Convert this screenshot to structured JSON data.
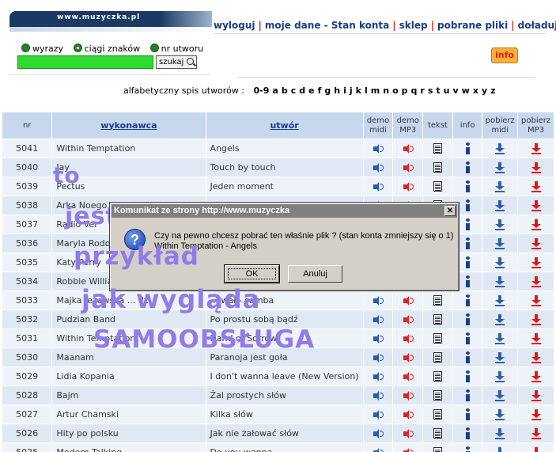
{
  "header": {
    "site_url": "www.muzyczka.pl",
    "nav": [
      "wyloguj",
      "moje dane - Stan konta",
      "sklep",
      "pobrane pliki",
      "doładuj konto"
    ],
    "info_badge": "info"
  },
  "search": {
    "options": [
      "wyrazy",
      "ciągi znaków",
      "nr utworu"
    ],
    "selected": "ciągi znaków",
    "input_value": "",
    "button_label": "szukaj"
  },
  "alphabet": {
    "label": "alfabetyczny spis utworów :",
    "letters": [
      "0-9",
      "a",
      "b",
      "c",
      "d",
      "e",
      "f",
      "g",
      "h",
      "i",
      "j",
      "k",
      "l",
      "m",
      "n",
      "o",
      "p",
      "q",
      "r",
      "s",
      "t",
      "u",
      "v",
      "w",
      "x",
      "y",
      "z"
    ]
  },
  "table": {
    "headers": {
      "nr": "nr",
      "artist": "wykonawca",
      "title": "utwór",
      "demo_midi": "demo midi",
      "demo_mp3": "demo MP3",
      "text": "tekst",
      "info": "info",
      "dl_midi": "pobierz midi",
      "dl_mp3": "pobierz MP3"
    },
    "rows": [
      {
        "nr": "5041",
        "artist": "Within Temptation",
        "title": "Angels"
      },
      {
        "nr": "5040",
        "artist": "Jay",
        "title": "Touch by touch"
      },
      {
        "nr": "5039",
        "artist": "Pectus",
        "title": "Jeden moment"
      },
      {
        "nr": "5038",
        "artist": "Arka Noego (c",
        "title": ""
      },
      {
        "nr": "5037",
        "artist": "Radio Ver",
        "title": ""
      },
      {
        "nr": "5036",
        "artist": "Maryla Rodow",
        "title": ""
      },
      {
        "nr": "5035",
        "artist": "Katy Perry",
        "title": ""
      },
      {
        "nr": "5034",
        "artist": "Robbie Williams",
        "title": ""
      },
      {
        "nr": "5033",
        "artist": "Majka Jeżowska ... dź",
        "title": "... wał - samba"
      },
      {
        "nr": "5032",
        "artist": "Pudzian Band",
        "title": "Po prostu sobą bądź"
      },
      {
        "nr": "5031",
        "artist": "Within Temptation",
        "title": "Hand of Sorrow"
      },
      {
        "nr": "5030",
        "artist": "Maanam",
        "title": "Paranoja jest goła"
      },
      {
        "nr": "5029",
        "artist": "Lidia Kopania",
        "title": "I don't wanna leave (New Version)"
      },
      {
        "nr": "5028",
        "artist": "Bajm",
        "title": "Żal prostych słów"
      },
      {
        "nr": "5027",
        "artist": "Artur Chamski",
        "title": "Kilka słów"
      },
      {
        "nr": "5026",
        "artist": "Hity po polsku",
        "title": "Jak nie żałować słów"
      },
      {
        "nr": "5025",
        "artist": "Modern Talking",
        "title": "Do you wanna"
      }
    ]
  },
  "dialog": {
    "title": "Komunikat ze strony http://www.muzyczka",
    "close_label": "✕",
    "message_line1": "Czy na pewno chcesz pobrać ten właśnie plik ? (stan konta zmniejszy się o 1)",
    "message_line2": "Within Temptation - Angels",
    "ok_label": "OK",
    "cancel_label": "Anuluj"
  },
  "overlay_text": [
    "to",
    "jest",
    "przykład",
    "jak wygląda",
    "SAMOOBSŁUGA"
  ],
  "colors": {
    "nav_link": "#1a3a8a",
    "nav_separator": "#e02020",
    "table_header": "#c8d8ec",
    "overlay": "#8f7ce8",
    "dialog_bg": "#d4d0c8"
  }
}
